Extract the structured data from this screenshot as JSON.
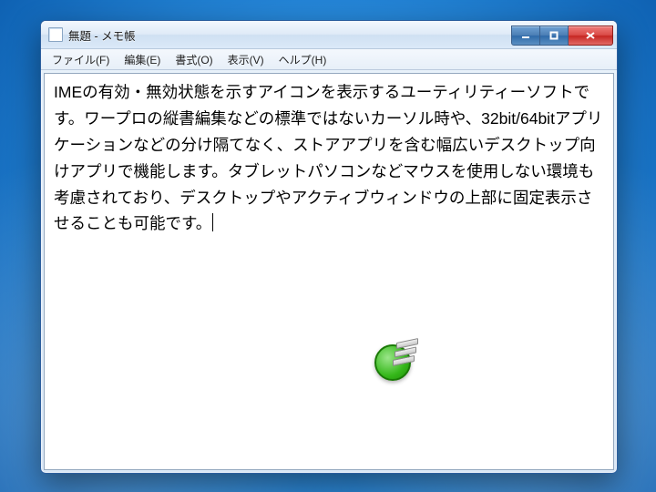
{
  "window": {
    "title": "無題 - メモ帳"
  },
  "menubar": {
    "items": [
      "ファイル(F)",
      "編集(E)",
      "書式(O)",
      "表示(V)",
      "ヘルプ(H)"
    ]
  },
  "editor": {
    "content": "IMEの有効・無効状態を示すアイコンを表示するユーティリティーソフトです。ワープロの縦書編集などの標準ではないカーソル時や、32bit/64bitアプリケーションなどの分け隔てなく、ストアアプリを含む幅広いデスクトップ向けアプリで機能します。タブレットパソコンなどマウスを使用しない環境も考慮されており、デスクトップやアクティブウィンドウの上部に固定表示させることも可能です。"
  },
  "ime": {
    "state": "enabled",
    "icon_name": "ime-enabled-indicator",
    "color": "#35b81a"
  }
}
